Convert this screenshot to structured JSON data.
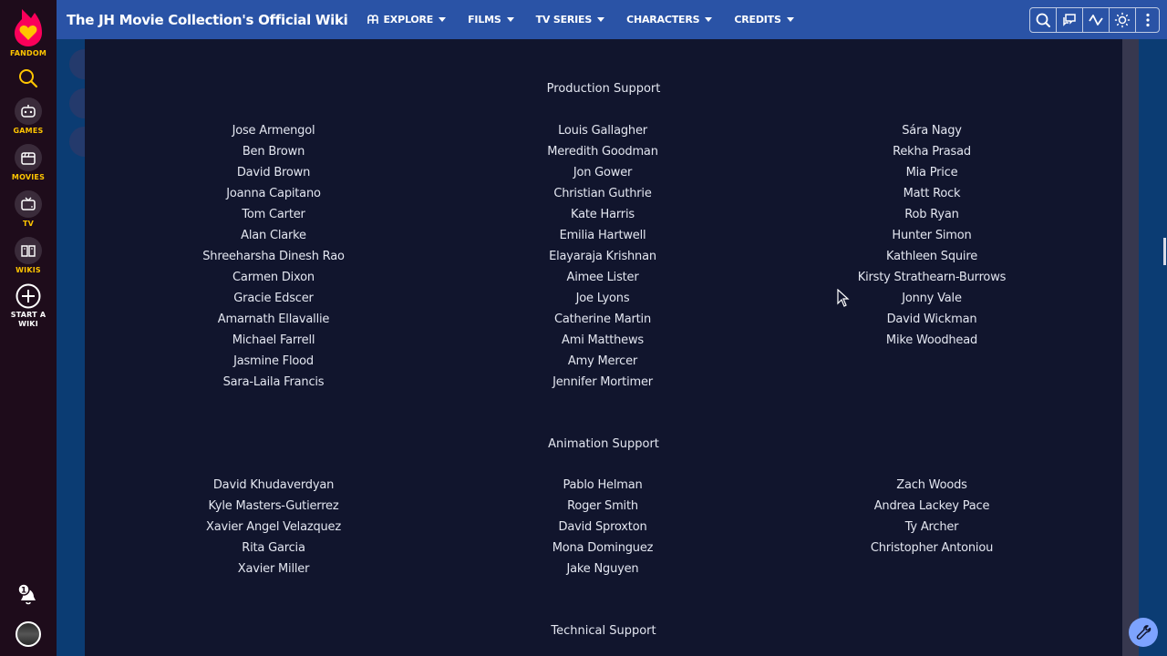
{
  "rail": {
    "brand": "FANDOM",
    "items": [
      {
        "label": "GAMES",
        "icon": "gamepad-icon"
      },
      {
        "label": "MOVIES",
        "icon": "clapperboard-icon"
      },
      {
        "label": "TV",
        "icon": "tv-icon"
      },
      {
        "label": "WIKIS",
        "icon": "book-icon"
      }
    ],
    "start_wiki_line1": "START A",
    "start_wiki_line2": "WIKI",
    "notification_count": "1"
  },
  "topbar": {
    "wiki_title": "The JH Movie Collection's Official Wiki",
    "nav": [
      {
        "label": "EXPLORE"
      },
      {
        "label": "FILMS"
      },
      {
        "label": "TV SERIES"
      },
      {
        "label": "CHARACTERS"
      },
      {
        "label": "CREDITS"
      }
    ],
    "tools": [
      "search-icon",
      "discussions-icon",
      "recent-changes-icon",
      "theme-toggle-icon",
      "more-options-icon"
    ]
  },
  "sections": [
    {
      "title": "Production Support",
      "columns": [
        [
          "Jose Armengol",
          "Ben Brown",
          "David Brown",
          "Joanna Capitano",
          "Tom Carter",
          "Alan Clarke",
          "Shreeharsha Dinesh Rao",
          "Carmen Dixon",
          "Gracie Edscer",
          "Amarnath Ellavallie",
          "Michael Farrell",
          "Jasmine Flood",
          "Sara-Laila Francis"
        ],
        [
          "Louis Gallagher",
          "Meredith Goodman",
          "Jon Gower",
          "Christian Guthrie",
          "Kate Harris",
          "Emilia Hartwell",
          "Elayaraja Krishnan",
          "Aimee Lister",
          "Joe Lyons",
          "Catherine Martin",
          "Ami Matthews",
          "Amy Mercer",
          "Jennifer Mortimer"
        ],
        [
          "Sára Nagy",
          "Rekha Prasad",
          "Mia Price",
          "Matt Rock",
          "Rob Ryan",
          "Hunter Simon",
          "Kathleen Squire",
          "Kirsty Strathearn-Burrows",
          "Jonny Vale",
          "David Wickman",
          "Mike Woodhead"
        ]
      ]
    },
    {
      "title": "Animation Support",
      "columns": [
        [
          "David Khudaverdyan",
          "Kyle Masters-Gutierrez",
          "Xavier Angel Velazquez",
          "Rita Garcia",
          "Xavier Miller"
        ],
        [
          "Pablo Helman",
          "Roger Smith",
          "David Sproxton",
          "Mona Dominguez",
          "Jake Nguyen"
        ],
        [
          "Zach Woods",
          "Andrea Lackey Pace",
          "Ty Archer",
          "Christopher Antoniou"
        ]
      ]
    },
    {
      "title": "Technical Support",
      "columns": []
    }
  ],
  "colors": {
    "rail_bg": "#1e0c1b",
    "fandom_yellow": "#ffc500",
    "topbar_bg": "#2a53a6",
    "content_bg": "#11152d",
    "text": "#e3e6f0",
    "accent": "#7da3ff"
  }
}
